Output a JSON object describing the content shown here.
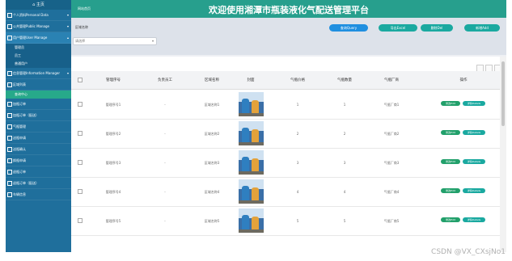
{
  "header": {
    "home_link": "网站首页",
    "title": "欢迎使用湘潭市瓶装液化气配送管理平台"
  },
  "sidebar": {
    "home": "主页",
    "items": [
      {
        "label": "个人资料Personal Data",
        "chevron": "▾"
      },
      {
        "label": "公共管理Public Manage",
        "chevron": "▾"
      },
      {
        "label": "用户管理User Manage",
        "chevron": "▴"
      },
      {
        "label": "管理员",
        "sub": true
      },
      {
        "label": "员工",
        "sub": true
      },
      {
        "label": "普通用户",
        "sub": true
      },
      {
        "label": "信息管理Information Manager",
        "chevron": "▾"
      },
      {
        "label": "区域列表",
        "chevron": ""
      },
      {
        "label": "查询中心",
        "sub": true,
        "active": true
      },
      {
        "label": "加瓶订单",
        "chevron": ""
      },
      {
        "label": "加瓶订单（配送）",
        "chevron": ""
      },
      {
        "label": "气瓶管理",
        "chevron": ""
      },
      {
        "label": "送瓶申请",
        "chevron": ""
      },
      {
        "label": "送瓶确认",
        "chevron": ""
      },
      {
        "label": "换瓶申请",
        "chevron": ""
      },
      {
        "label": "退瓶订单",
        "chevron": ""
      },
      {
        "label": "退瓶订单（配送）",
        "chevron": ""
      },
      {
        "label": "车辆信息",
        "chevron": ""
      }
    ]
  },
  "search": {
    "label": "区域名称",
    "placeholder": "请选择",
    "arrow": "▾"
  },
  "buttons": {
    "query": "查询Query",
    "export": "导出Excel",
    "delete": "删除Del",
    "add": "新增Add"
  },
  "table": {
    "headers": [
      "管理序号",
      "负责员工",
      "区域名称",
      "封面",
      "气瓶价格",
      "气瓶数量",
      "气瓶厂商",
      "操作"
    ],
    "rows": [
      {
        "no": "管理序号1",
        "staff": "-",
        "area": "区域名称1",
        "price": "1",
        "qty": "1",
        "maker": "气瓶厂商1"
      },
      {
        "no": "管理序号2",
        "staff": "-",
        "area": "区域名称2",
        "price": "2",
        "qty": "2",
        "maker": "气瓶厂商2"
      },
      {
        "no": "管理序号3",
        "staff": "-",
        "area": "区域名称3",
        "price": "3",
        "qty": "3",
        "maker": "气瓶厂商3"
      },
      {
        "no": "管理序号4",
        "staff": "-",
        "area": "区域名称4",
        "price": "4",
        "qty": "4",
        "maker": "气瓶厂商4"
      },
      {
        "no": "管理序号5",
        "staff": "-",
        "area": "区域名称5",
        "price": "5",
        "qty": "5",
        "maker": "气瓶厂商5"
      }
    ],
    "action_edit": "修改Edit",
    "action_detail": "详情Details"
  },
  "watermark": "CSDN @VX_CXsjNo1"
}
